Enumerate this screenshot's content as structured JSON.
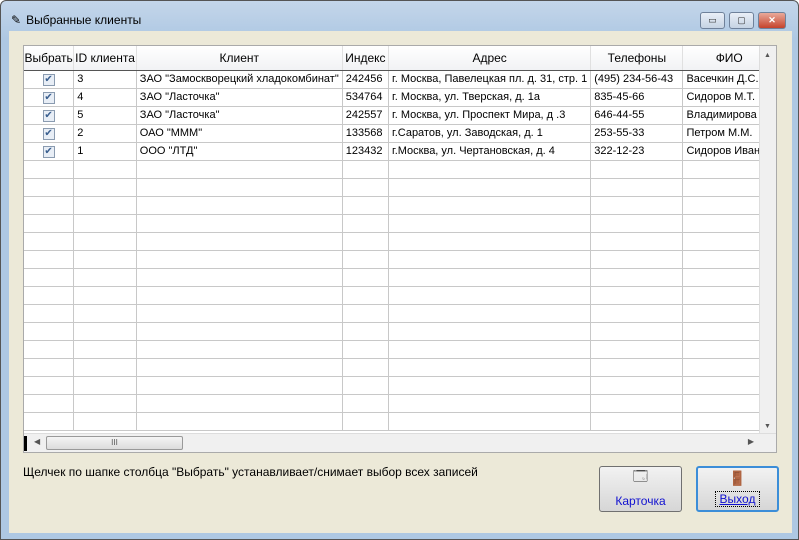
{
  "window": {
    "title": "Выбранные клиенты",
    "min": "▭",
    "max": "▢",
    "close": "✕"
  },
  "grid": {
    "columns": [
      "Выбрать",
      "ID клиента",
      "Клиент",
      "Индекс",
      "Адрес",
      "Телефоны",
      "ФИО"
    ],
    "rows": [
      {
        "checked": true,
        "id": "3",
        "client": "ЗАО \"Замоскворецкий хладокомбинат\"",
        "index": "242456",
        "address": "г. Москва, Павелецкая пл. д. 31, стр. 1",
        "phones": "(495) 234-56-43",
        "fio": "Васечкин Д.С."
      },
      {
        "checked": true,
        "id": "4",
        "client": "ЗАО \"Ласточка\"",
        "index": "534764",
        "address": "г. Москва, ул. Тверская, д. 1а",
        "phones": "835-45-66",
        "fio": "Сидоров М.Т."
      },
      {
        "checked": true,
        "id": "5",
        "client": "ЗАО \"Ласточка\"",
        "index": "242557",
        "address": "г. Москва,  ул. Проспект Мира, д .3",
        "phones": "646-44-55",
        "fio": "Владимирова М."
      },
      {
        "checked": true,
        "id": "2",
        "client": "ОАО \"МММ\"",
        "index": "133568",
        "address": "г.Саратов, ул. Заводская, д. 1",
        "phones": "253-55-33",
        "fio": "Петром М.М."
      },
      {
        "checked": true,
        "id": "1",
        "client": "ООО \"ЛТД\"",
        "index": "123432",
        "address": "г.Москва, ул. Чертановская, д. 4",
        "phones": "322-12-23",
        "fio": "Сидоров Иван"
      }
    ],
    "empty_rows": 15,
    "scroll_thumb": "III"
  },
  "hint": "Щелчек по шапке столбца \"Выбрать\" устанавливает/снимает выбор всех записей",
  "buttons": {
    "card": "Карточка",
    "exit": "Выход"
  }
}
